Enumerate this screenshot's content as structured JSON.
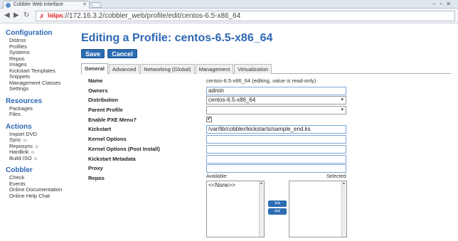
{
  "browser": {
    "tab_title": "Cobbler Web Interface",
    "url_proto": "https",
    "url_rest": "://172.16.3.2/cobbler_web/profile/edit/centos-6.5-x86_64"
  },
  "sidebar": {
    "sections": [
      {
        "title": "Configuration",
        "items": [
          "Distros",
          "Profiles",
          "Systems",
          "Repos",
          "Images",
          "Kickstart Templates",
          "Snippets",
          "Management Classes",
          "Settings"
        ]
      },
      {
        "title": "Resources",
        "items": [
          "Packages",
          "Files"
        ]
      },
      {
        "title": "Actions",
        "items": [
          "Import DVD",
          "Sync ☼",
          "Reposync ☼",
          "Hardlink ☼",
          "Build ISO ☼"
        ]
      },
      {
        "title": "Cobbler",
        "items": [
          "Check",
          "Events",
          "Online Documentation",
          "Online Help Chat"
        ]
      }
    ]
  },
  "main": {
    "title": "Editing a Profile: centos-6.5-x86_64",
    "save_label": "Save",
    "cancel_label": "Cancel",
    "tabs": [
      "General",
      "Advanced",
      "Networking (Global)",
      "Management",
      "Virtualization"
    ],
    "fields": {
      "name_label": "Name",
      "name_value": "centos-6.5-x86_64 (editing, value is read-only)",
      "owners_label": "Owners",
      "owners_value": "admin",
      "distribution_label": "Distribution",
      "distribution_value": "centos-6.5-x86_64",
      "parent_label": "Parent Profile",
      "parent_value": "",
      "pxe_label": "Enable PXE Menu?",
      "pxe_check": "✔",
      "kickstart_label": "Kickstart",
      "kickstart_value": "/var/lib/cobbler/kickstarts/sample_end.ks",
      "kopts_label": "Kernel Options",
      "kopts_value": "",
      "kopts_post_label": "Kernel Options (Post Install)",
      "kopts_post_value": "",
      "ksmeta_label": "Kickstart Metadata",
      "ksmeta_value": "",
      "proxy_label": "Proxy",
      "proxy_value": "",
      "repos_label": "Repos",
      "available_label": "Available:",
      "selected_label": "Selected:",
      "available_option": "<<None>>",
      "add_label": ">>",
      "remove_label": "<<"
    }
  }
}
